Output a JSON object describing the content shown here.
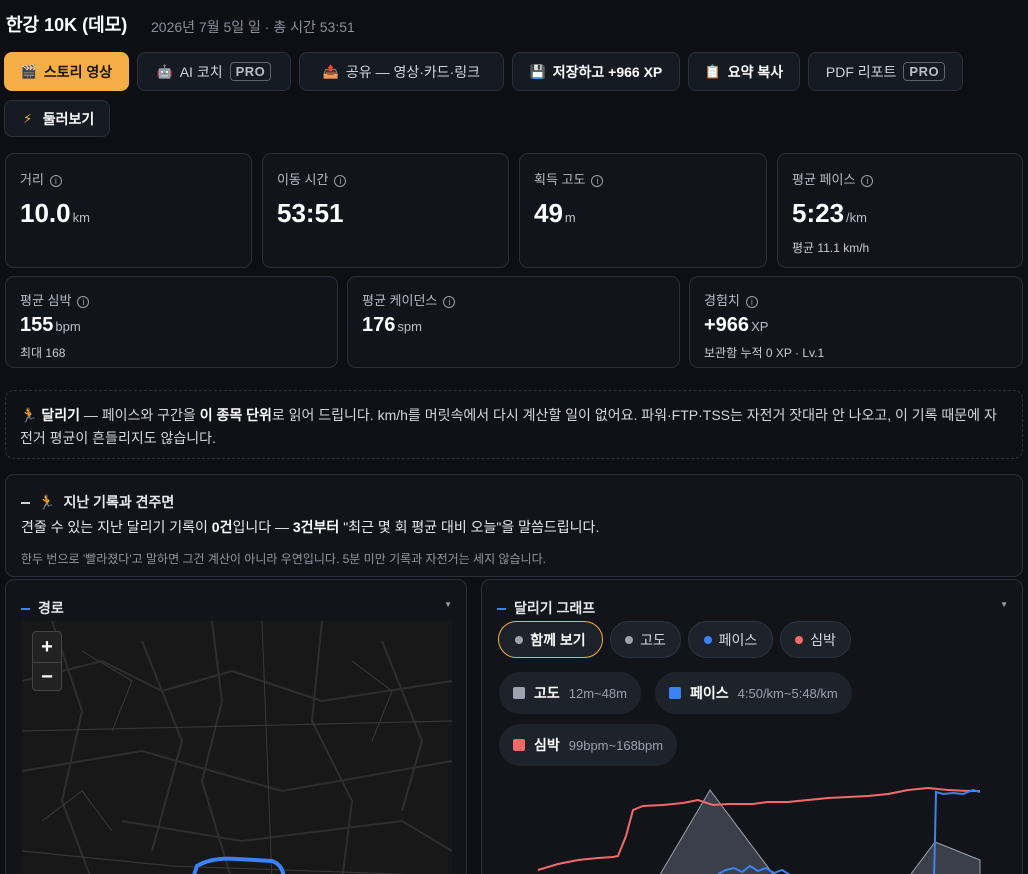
{
  "header": {
    "title": "한강 10K (데모)",
    "subtitle": "2026년 7월 5일 일 · 총 시간 53:51"
  },
  "actions": {
    "story": "스토리 영상",
    "ai_coach": "AI 코치",
    "pro": "PRO",
    "share": "공유 — 영상·카드·링크",
    "save": "저장하고 +966 XP",
    "copy_summary": "요약 복사",
    "pdf_report": "PDF 리포트",
    "browse": "둘러보기"
  },
  "stats": {
    "distance": {
      "label": "거리",
      "value": "10.0",
      "unit": "km"
    },
    "moving_time": {
      "label": "이동 시간",
      "value": "53:51"
    },
    "elevation": {
      "label": "획득 고도",
      "value": "49",
      "unit": "m"
    },
    "pace": {
      "label": "평균 페이스",
      "value": "5:23",
      "unit": "/km",
      "sub": "평균 11.1 km/h"
    },
    "heart_rate": {
      "label": "평균 심박",
      "value": "155",
      "unit": "bpm",
      "sub": "최대 168"
    },
    "cadence": {
      "label": "평균 케이던스",
      "value": "176",
      "unit": "spm"
    },
    "xp": {
      "label": "경험치",
      "value": "+966",
      "unit": "XP",
      "sub": "보관함 누적 0 XP · Lv.1"
    }
  },
  "notice": {
    "sport": "달리기",
    "t1": " — 페이스와 구간을 ",
    "emph": "이 종목 단위",
    "t2": "로 읽어 드립니다. km/h를 머릿속에서 다시 계산할 일이 없어요. 파워·FTP·TSS는 자전거 잣대라 안 나오고, 이 기록 때문에 자전거 평균이 흔들리지도 않습니다."
  },
  "history": {
    "title": "지난 기록과 견주면",
    "l1": "견줄 수 있는 지난 달리기 기록이 ",
    "count": "0건",
    "l2": "입니다 — ",
    "threshold": "3건부터",
    "l3": " \"최근 몇 회 평균 대비 오늘\"을 말씀드립니다.",
    "note": "한두 번으로 '빨라졌다'고 말하면 그건 계산이 아니라 우연입니다. 5분 미만 기록과 자전거는 세지 않습니다."
  },
  "route": {
    "title": "경로",
    "zoom_in": "+",
    "zoom_out": "−"
  },
  "graph": {
    "title": "달리기 그래프",
    "chips": [
      "함께 보기",
      "고도",
      "페이스",
      "심박"
    ],
    "legend": {
      "elevation": {
        "name": "고도",
        "range": "12m~48m"
      },
      "pace": {
        "name": "페이스",
        "range": "4:50/km~5:48/km"
      },
      "heart": {
        "name": "심박",
        "range": "99bpm~168bpm"
      }
    }
  },
  "colors": {
    "accent": "#f5ad46",
    "elevation": "#9ca3af",
    "pace": "#3b82f6",
    "heart": "#f06a6a"
  }
}
